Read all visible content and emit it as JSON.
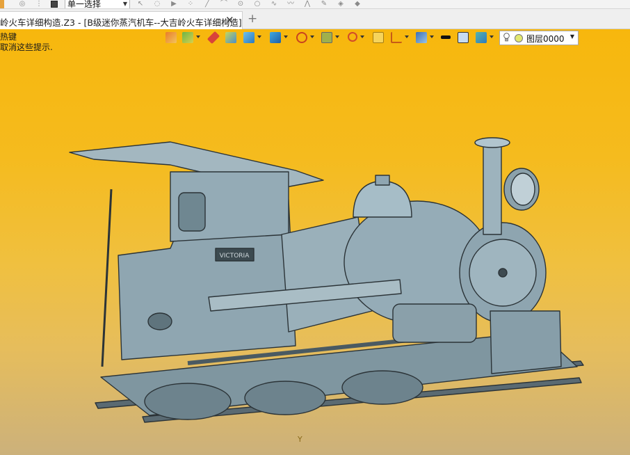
{
  "toolbar": {
    "select_mode": "单一选择",
    "icons": [
      "filter-icon",
      "snap-icon",
      "pick-icon",
      "stop-icon",
      "cursor-icon",
      "lasso-icon",
      "line-icon",
      "arc-icon",
      "circle-icon",
      "spline-icon",
      "curve-icon",
      "wave-icon",
      "trim-icon",
      "eye-icon",
      "eraser-icon"
    ]
  },
  "tabs": {
    "doc_title": "岭火车详细构造.Z3 - [B级迷你蒸汽机车--大吉岭火车详细构造]",
    "close": "✕",
    "new_tab": "+"
  },
  "viewport": {
    "hint_line1": "热键",
    "hint_line2": "取消这些提示.",
    "layer_name": "图层0000",
    "axis_label": "Y",
    "model_name": "VICTORIA",
    "background_top": "#f7b70d",
    "background_bottom": "#ccb17b",
    "model_color": "#8fa6b1"
  }
}
